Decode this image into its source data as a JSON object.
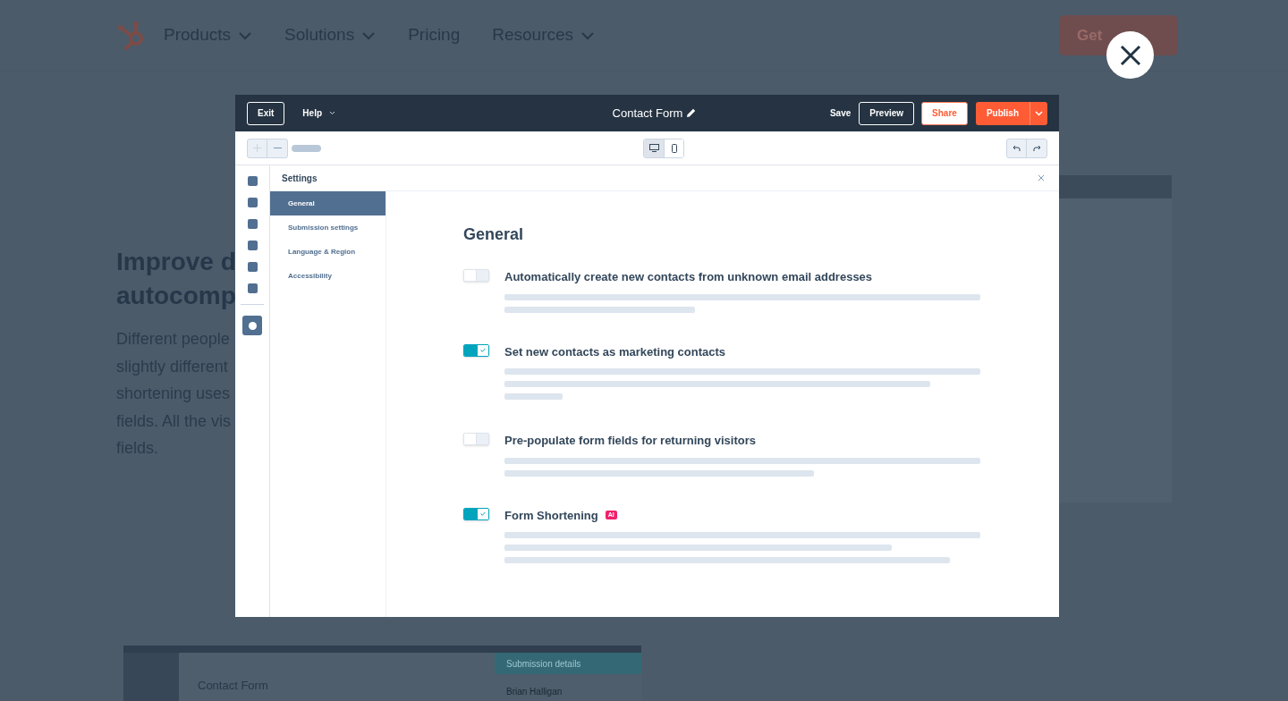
{
  "nav": {
    "items": [
      {
        "label": "Products",
        "dropdown": true
      },
      {
        "label": "Solutions",
        "dropdown": true
      },
      {
        "label": "Pricing",
        "dropdown": false
      },
      {
        "label": "Resources",
        "dropdown": true
      }
    ],
    "cta": "Get"
  },
  "section": {
    "heading_lines": [
      "Improve d",
      "autocomp"
    ],
    "body_lines": [
      "Different people",
      "slightly different",
      "shortening uses",
      "fields. All the vis",
      "fields."
    ]
  },
  "preview": {
    "title": "Contact Form",
    "panel_title": "Submission details",
    "contact": "Brian Halligan"
  },
  "editor": {
    "exit": "Exit",
    "help": "Help",
    "title": "Contact Form",
    "save": "Save",
    "preview": "Preview",
    "share": "Share",
    "publish": "Publish",
    "devices": [
      {
        "kind": "desktop",
        "selected": true
      },
      {
        "kind": "mobile",
        "selected": false
      }
    ],
    "settings_title": "Settings",
    "menu": [
      {
        "label": "General",
        "selected": true
      },
      {
        "label": "Submission settings",
        "selected": false
      },
      {
        "label": "Language & Region",
        "selected": false
      },
      {
        "label": "Accessibility",
        "selected": false
      }
    ],
    "heading": "General",
    "options": [
      {
        "label": "Automatically create new contacts from unknown email addresses",
        "on": false
      },
      {
        "label": "Set new contacts as marketing contacts",
        "on": true
      },
      {
        "label": "Pre-populate form fields for returning visitors",
        "on": false
      },
      {
        "label": "Form Shortening",
        "on": true,
        "badge": "AI"
      }
    ]
  }
}
